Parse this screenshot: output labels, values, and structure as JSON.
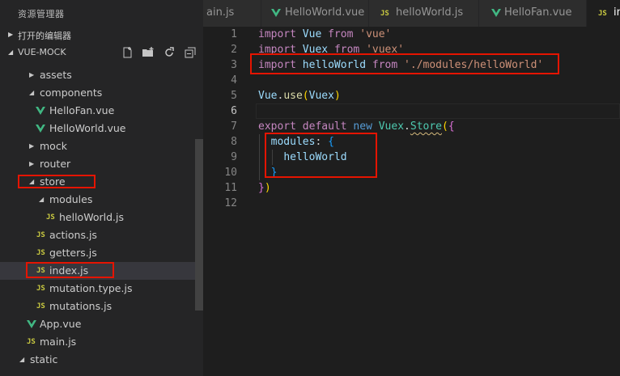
{
  "sidebar": {
    "title": "资源管理器",
    "open_editors": "打开的编辑器",
    "project": "VUE-MOCK",
    "actions": [
      "new-file-icon",
      "new-folder-icon",
      "refresh-icon",
      "collapse-all-icon"
    ],
    "tree": [
      {
        "label": "assets",
        "kind": "folder",
        "open": false
      },
      {
        "label": "components",
        "kind": "folder",
        "open": true
      },
      {
        "label": "HelloFan.vue",
        "kind": "vue"
      },
      {
        "label": "HelloWorld.vue",
        "kind": "vue"
      },
      {
        "label": "mock",
        "kind": "folder",
        "open": false
      },
      {
        "label": "router",
        "kind": "folder",
        "open": false
      },
      {
        "label": "store",
        "kind": "folder",
        "open": true
      },
      {
        "label": "modules",
        "kind": "folder",
        "open": true
      },
      {
        "label": "helloWorld.js",
        "kind": "js"
      },
      {
        "label": "actions.js",
        "kind": "js"
      },
      {
        "label": "getters.js",
        "kind": "js"
      },
      {
        "label": "index.js",
        "kind": "js",
        "selected": true
      },
      {
        "label": "mutation.type.js",
        "kind": "js"
      },
      {
        "label": "mutations.js",
        "kind": "js"
      },
      {
        "label": "App.vue",
        "kind": "vue"
      },
      {
        "label": "main.js",
        "kind": "js"
      },
      {
        "label": "static",
        "kind": "folder",
        "open": true
      }
    ]
  },
  "tabs": [
    {
      "label": "ain.js",
      "kind": "js"
    },
    {
      "label": "HelloWorld.vue",
      "kind": "vue"
    },
    {
      "label": "helloWorld.js",
      "kind": "js"
    },
    {
      "label": "HelloFan.vue",
      "kind": "vue"
    },
    {
      "label": "in",
      "kind": "js",
      "active": true
    }
  ],
  "badges": {
    "js": "JS"
  },
  "editor": {
    "line_numbers": [
      "1",
      "2",
      "3",
      "4",
      "5",
      "6",
      "7",
      "8",
      "9",
      "10",
      "11",
      "12"
    ],
    "current_line": "6",
    "tokens": {
      "import": "import",
      "from": "from",
      "vue_id": "Vue",
      "vue_str": "'vue'",
      "vuex_id": "Vuex",
      "vuex_str": "'vuex'",
      "helloworld_id": "helloWorld",
      "helloworld_str": "'./modules/helloWorld'",
      "vue_use_obj": "Vue",
      "dot": ".",
      "use_fn": "use",
      "paren_open": "(",
      "paren_close": ")",
      "vuex_arg": "Vuex",
      "export": "export",
      "default": "default",
      "new": "new",
      "vuex_cls": "Vuex",
      "store_cls": "Store",
      "brace_open": "{",
      "brace_close": "}",
      "modules_key": "modules",
      "colon": ":",
      "helloworld_val": "helloWorld",
      "close_all": "})"
    }
  },
  "colors": {
    "highlight": "#e51400",
    "js_badge": "#cbcb41",
    "vue_badge": "#41b883"
  }
}
